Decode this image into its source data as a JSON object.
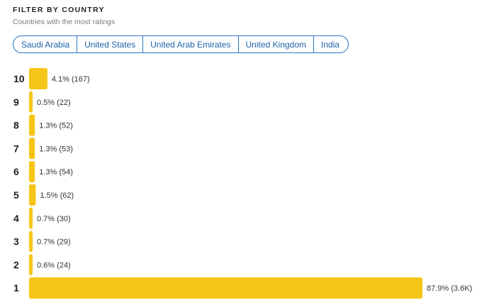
{
  "header": {
    "title": "FILTER BY COUNTRY",
    "subtitle": "Countries with the most ratings"
  },
  "filters": {
    "countries": [
      "Saudi Arabia",
      "United States",
      "United Arab Emirates",
      "United Kingdom",
      "India"
    ],
    "border_color": "#2f78c0",
    "text_color": "#1e63a8"
  },
  "chart_data": {
    "type": "bar",
    "orientation": "horizontal",
    "categories": [
      "10",
      "9",
      "8",
      "7",
      "6",
      "5",
      "4",
      "3",
      "2",
      "1"
    ],
    "values": [
      4.1,
      0.5,
      1.3,
      1.3,
      1.3,
      1.5,
      0.7,
      0.7,
      0.6,
      87.9
    ],
    "counts": [
      "167",
      "22",
      "52",
      "53",
      "54",
      "62",
      "30",
      "29",
      "24",
      "3.6K"
    ],
    "labels": [
      "4.1% (167)",
      "0.5% (22)",
      "1.3% (52)",
      "1.3% (53)",
      "1.3% (54)",
      "1.5% (62)",
      "0.7% (30)",
      "0.7% (29)",
      "0.6% (24)",
      "87.9% (3.6K)"
    ],
    "unit": "%",
    "bar_color": "#f5c518",
    "grid": false,
    "legend": "none"
  }
}
